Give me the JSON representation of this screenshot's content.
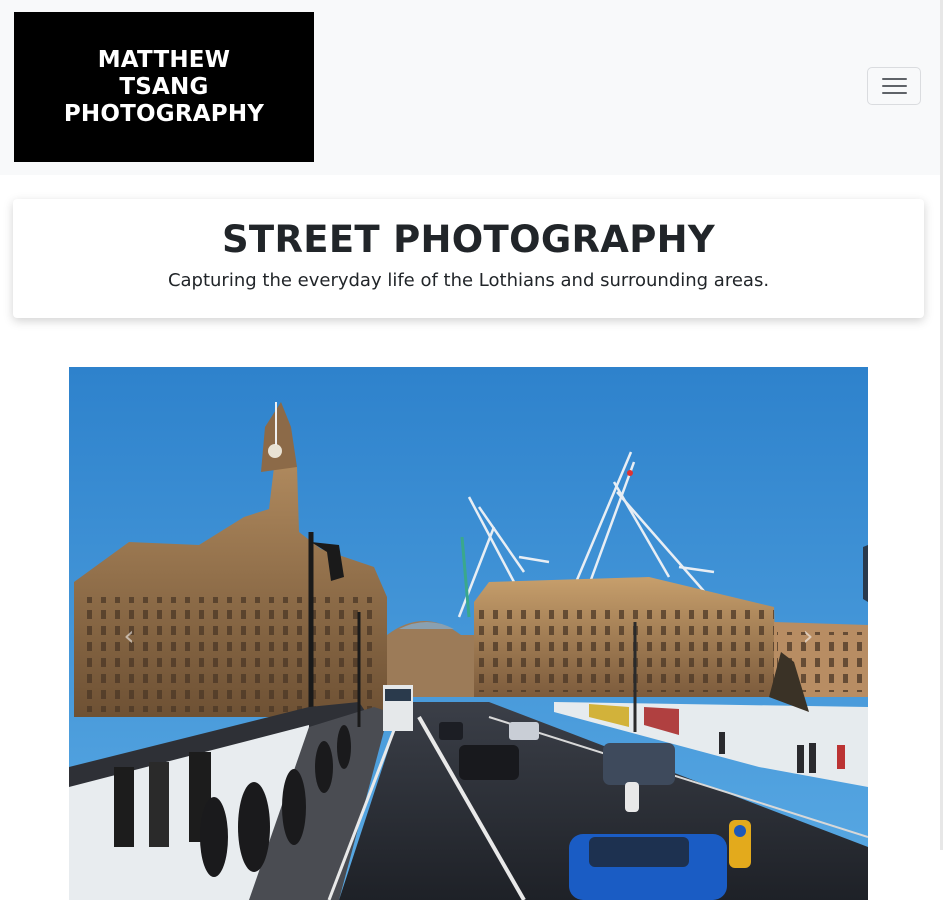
{
  "brand": {
    "logo_line1": "MATTHEW",
    "logo_line2": "TSANG",
    "logo_line3": "PHOTOGRAPHY"
  },
  "nav": {
    "toggler_icon": "hamburger-menu-icon"
  },
  "header": {
    "title": "STREET PHOTOGRAPHY",
    "subtitle": "Capturing the everyday life of the Lothians and surrounding areas."
  },
  "carousel": {
    "prev_icon": "chevron-left-icon",
    "next_icon": "chevron-right-icon",
    "prev_glyph": "‹",
    "next_glyph": "›"
  },
  "colors": {
    "navbar_bg": "#f8f9fa",
    "logo_bg": "#000000",
    "sky": "#3a8fd4",
    "text": "#212529"
  }
}
